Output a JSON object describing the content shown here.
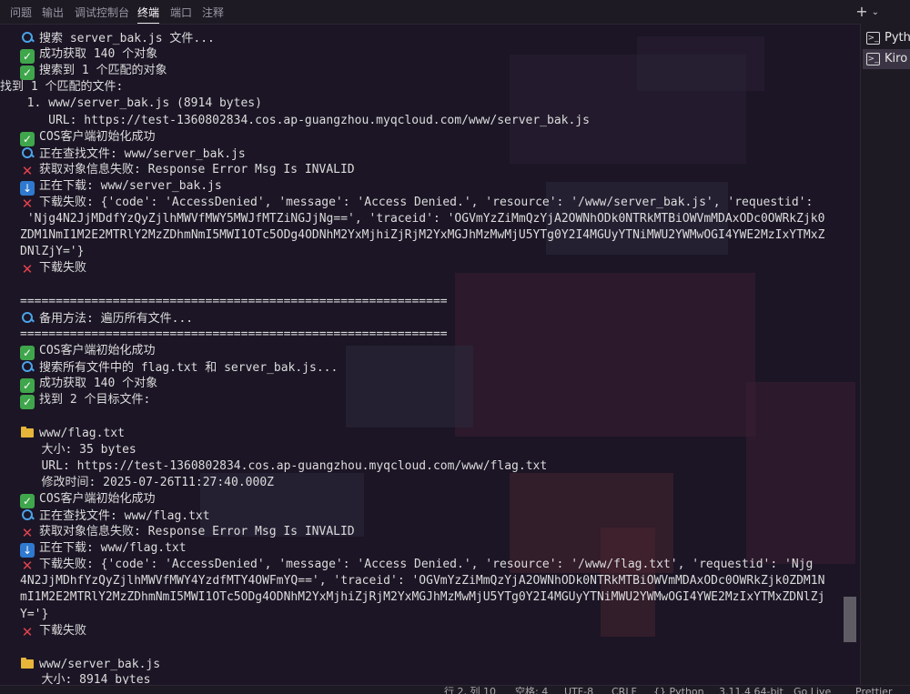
{
  "tabs": [
    "问题",
    "输出",
    "调试控制台",
    "终端",
    "端口",
    "注释"
  ],
  "active_tab": "终端",
  "tab_actions": {
    "add": "+",
    "dropdown": "⌄"
  },
  "terminal_lines": [
    {
      "icon": "search",
      "text": "搜索 server_bak.js 文件..."
    },
    {
      "icon": "check",
      "text": "成功获取 140 个对象"
    },
    {
      "icon": "check",
      "text": "搜索到 1 个匹配的对象"
    },
    {
      "icon": "",
      "text": "找到 1 个匹配的文件:",
      "indent": -22
    },
    {
      "icon": "",
      "text": "  1. www/server_bak.js (8914 bytes)",
      "indent": -8
    },
    {
      "icon": "",
      "text": "     URL: https://test-1360802834.cos.ap-guangzhou.myqcloud.com/www/server_bak.js",
      "indent": -8
    },
    {
      "icon": "check",
      "text": "COS客户端初始化成功"
    },
    {
      "icon": "search",
      "text": "正在查找文件: www/server_bak.js"
    },
    {
      "icon": "cross",
      "text": "获取对象信息失败: Response Error Msg Is INVALID"
    },
    {
      "icon": "down",
      "text": "正在下载: www/server_bak.js"
    },
    {
      "icon": "cross",
      "text": "下载失败: {'code': 'AccessDenied', 'message': 'Access Denied.', 'resource': '/www/server_bak.js', 'requestid':"
    },
    {
      "icon": "",
      "text": " 'Njg4N2JjMDdfYzQyZjlhMWVfMWY5MWJfMTZiNGJjNg==', 'traceid': 'OGVmYzZiMmQzYjA2OWNhODk0NTRkMTBiOWVmMDAxODc0OWRkZjk0"
    },
    {
      "icon": "",
      "text": "ZDM1NmI1M2E2MTRlY2MzZDhmNmI5MWI1OTc5ODg4ODNhM2YxMjhiZjRjM2YxMGJhMzMwMjU5YTg0Y2I4MGUyYTNiMWU2YWMwOGI4YWE2MzIxYTMxZ"
    },
    {
      "icon": "",
      "text": "DNlZjY='}"
    },
    {
      "icon": "cross",
      "text": "下载失败"
    },
    {
      "icon": "",
      "text": ""
    },
    {
      "icon": "",
      "text": "============================================================"
    },
    {
      "icon": "search",
      "text": "备用方法: 遍历所有文件..."
    },
    {
      "icon": "",
      "text": "============================================================"
    },
    {
      "icon": "check",
      "text": "COS客户端初始化成功"
    },
    {
      "icon": "search",
      "text": "搜索所有文件中的 flag.txt 和 server_bak.js..."
    },
    {
      "icon": "check",
      "text": "成功获取 140 个对象"
    },
    {
      "icon": "check",
      "text": "找到 2 个目标文件:"
    },
    {
      "icon": "",
      "text": ""
    },
    {
      "icon": "folder",
      "text": "www/flag.txt"
    },
    {
      "icon": "",
      "text": "   大小: 35 bytes"
    },
    {
      "icon": "",
      "text": "   URL: https://test-1360802834.cos.ap-guangzhou.myqcloud.com/www/flag.txt"
    },
    {
      "icon": "",
      "text": "   修改时间: 2025-07-26T11:27:40.000Z"
    },
    {
      "icon": "check",
      "text": "COS客户端初始化成功"
    },
    {
      "icon": "search",
      "text": "正在查找文件: www/flag.txt"
    },
    {
      "icon": "cross",
      "text": "获取对象信息失败: Response Error Msg Is INVALID"
    },
    {
      "icon": "down",
      "text": "正在下载: www/flag.txt"
    },
    {
      "icon": "cross",
      "text": "下载失败: {'code': 'AccessDenied', 'message': 'Access Denied.', 'resource': '/www/flag.txt', 'requestid': 'Njg"
    },
    {
      "icon": "",
      "text": "4N2JjMDhfYzQyZjlhMWVfMWY4YzdfMTY4OWFmYQ==', 'traceid': 'OGVmYzZiMmQzYjA2OWNhODk0NTRkMTBiOWVmMDAxODc0OWRkZjk0ZDM1N"
    },
    {
      "icon": "",
      "text": "mI1M2E2MTRlY2MzZDhmNmI5MWI1OTc5ODg4ODNhM2YxMjhiZjRjM2YxMGJhMzMwMjU5YTg0Y2I4MGUyYTNiMWU2YWMwOGI4YWE2MzIxYTMxZDNlZj"
    },
    {
      "icon": "",
      "text": "Y='}"
    },
    {
      "icon": "cross",
      "text": "下载失败"
    },
    {
      "icon": "",
      "text": ""
    },
    {
      "icon": "folder",
      "text": "www/server_bak.js"
    },
    {
      "icon": "",
      "text": "   大小: 8914 bytes"
    }
  ],
  "side_panel": [
    {
      "icon": ">_",
      "label": "Pyth"
    },
    {
      "icon": ">_",
      "label": "Kiro"
    }
  ],
  "status_bar": [
    "行 2, 列 10",
    "空格: 4",
    "UTF-8",
    "CRLF",
    "{} Python",
    "3.11.4 64-bit",
    "Go Live",
    "Prettier"
  ]
}
